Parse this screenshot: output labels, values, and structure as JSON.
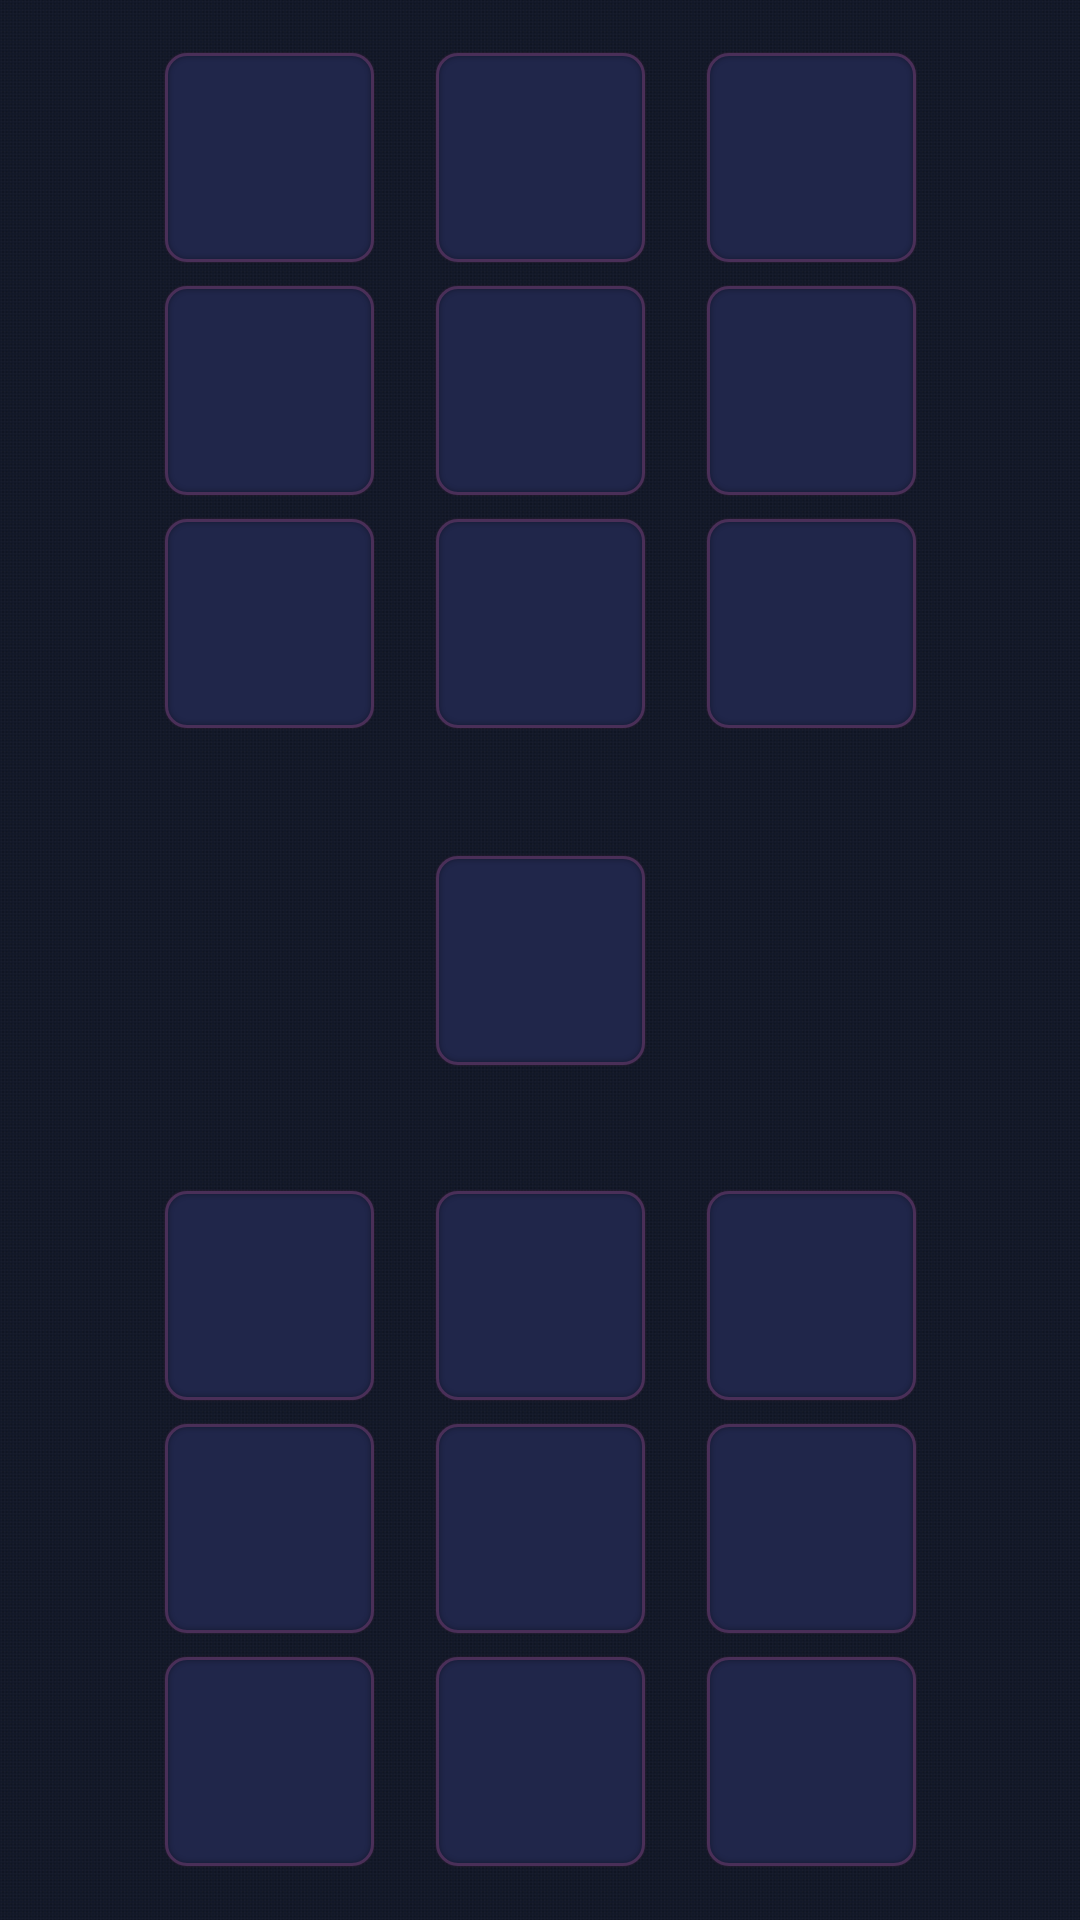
{
  "theme": {
    "background": "#121828",
    "tile_fill": "#20264a",
    "tile_border": "#4a2f58"
  },
  "board": {
    "top_grid": {
      "rows": 3,
      "cols": 3
    },
    "center_tile": {
      "count": 1
    },
    "bottom_grid": {
      "rows": 3,
      "cols": 3
    }
  }
}
